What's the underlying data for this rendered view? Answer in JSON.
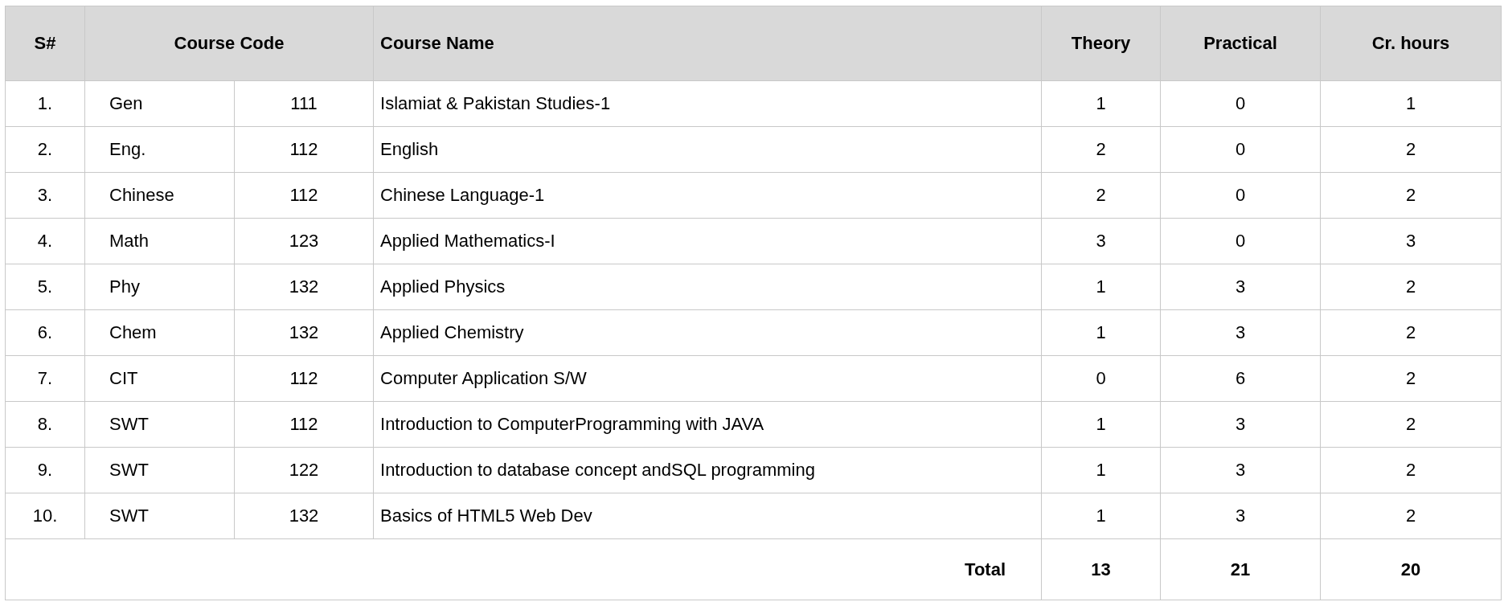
{
  "table": {
    "columns": [
      {
        "label": "S#"
      },
      {
        "label": "Course Code"
      },
      {
        "label": "Course Name"
      },
      {
        "label": "Theory"
      },
      {
        "label": "Practical"
      },
      {
        "label": "Cr. hours"
      }
    ],
    "rows": [
      {
        "sn": "1.",
        "code_prefix": "Gen",
        "code_number": "111",
        "name": "Islamiat & Pakistan Studies-1",
        "theory": "1",
        "practical": "0",
        "credit_hours": "1"
      },
      {
        "sn": "2.",
        "code_prefix": "Eng.",
        "code_number": "112",
        "name": "English",
        "theory": "2",
        "practical": "0",
        "credit_hours": "2"
      },
      {
        "sn": "3.",
        "code_prefix": "Chinese",
        "code_number": "112",
        "name": "Chinese Language-1",
        "theory": "2",
        "practical": "0",
        "credit_hours": "2"
      },
      {
        "sn": "4.",
        "code_prefix": "Math",
        "code_number": "123",
        "name": "Applied Mathematics-I",
        "theory": "3",
        "practical": "0",
        "credit_hours": "3"
      },
      {
        "sn": "5.",
        "code_prefix": "Phy",
        "code_number": "132",
        "name": "Applied Physics",
        "theory": "1",
        "practical": "3",
        "credit_hours": "2"
      },
      {
        "sn": "6.",
        "code_prefix": "Chem",
        "code_number": "132",
        "name": "Applied Chemistry",
        "theory": "1",
        "practical": "3",
        "credit_hours": "2"
      },
      {
        "sn": "7.",
        "code_prefix": "CIT",
        "code_number": "112",
        "name": "Computer Application S/W",
        "theory": "0",
        "practical": "6",
        "credit_hours": "2"
      },
      {
        "sn": "8.",
        "code_prefix": "SWT",
        "code_number": "112",
        "name": "Introduction to ComputerProgramming with JAVA",
        "theory": "1",
        "practical": "3",
        "credit_hours": "2"
      },
      {
        "sn": "9.",
        "code_prefix": "SWT",
        "code_number": "122",
        "name": "Introduction to database concept andSQL programming",
        "theory": "1",
        "practical": "3",
        "credit_hours": "2"
      },
      {
        "sn": "10.",
        "code_prefix": "SWT",
        "code_number": "132",
        "name": "Basics of HTML5 Web Dev",
        "theory": "1",
        "practical": "3",
        "credit_hours": "2"
      }
    ],
    "total": {
      "label": "Total",
      "theory": "13",
      "practical": "21",
      "credit_hours": "20"
    }
  }
}
